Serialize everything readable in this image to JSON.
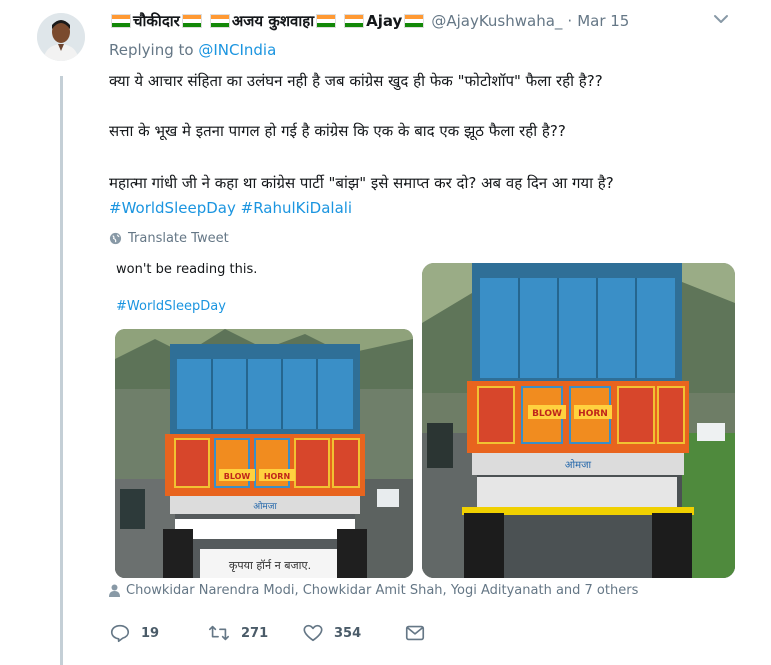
{
  "author": {
    "name_part1": "चौकीदार",
    "name_part2": "अजय कुशवाहा",
    "name_part3": "Ajay",
    "handle": "@AjayKushwaha_",
    "separator": "·",
    "time": "Mar 15"
  },
  "reply_label": "Replying to",
  "reply_to": "@INCIndia",
  "tweet": {
    "line1": "क्या ये आचार संहिता का उलंघन नही है जब कांग्रेस खुद ही फेक \"फोटोशॉप\" फैला रही है??",
    "line2": "सत्ता के भूख मे इतना पागल हो गई है कांग्रेस कि एक के बाद एक झूठ फैला रही है??",
    "line3": "महात्मा गांधी जी ने कहा था कांग्रेस पार्टी \"बांझ\" इसे समाप्त कर दो? अब वह दिन आ गया है?",
    "hashtag1": "#WorldSleepDay",
    "hashtag2": "#RahulKiDalali"
  },
  "translate_label": "Translate Tweet",
  "media": {
    "left_caption": "won't be reading this.",
    "left_hashtag": "#WorldSleepDay",
    "truck_sign_left": "BLOW",
    "truck_sign_right": "HORN",
    "truck_brand": "ओमजा",
    "truck_plate": "कृपया हॉर्न न बजाए."
  },
  "retweeted_by": "Chowkidar Narendra Modi, Chowkidar Amit Shah, Yogi Adityanath and 7 others",
  "actions": {
    "replies": "19",
    "retweets": "271",
    "likes": "354"
  },
  "colors": {
    "link": "#1b95e0",
    "muted": "#657786",
    "saffron": "#ff9933",
    "india_green": "#138808",
    "truck_blue": "#3a8fc7",
    "truck_orange": "#e8641e"
  }
}
